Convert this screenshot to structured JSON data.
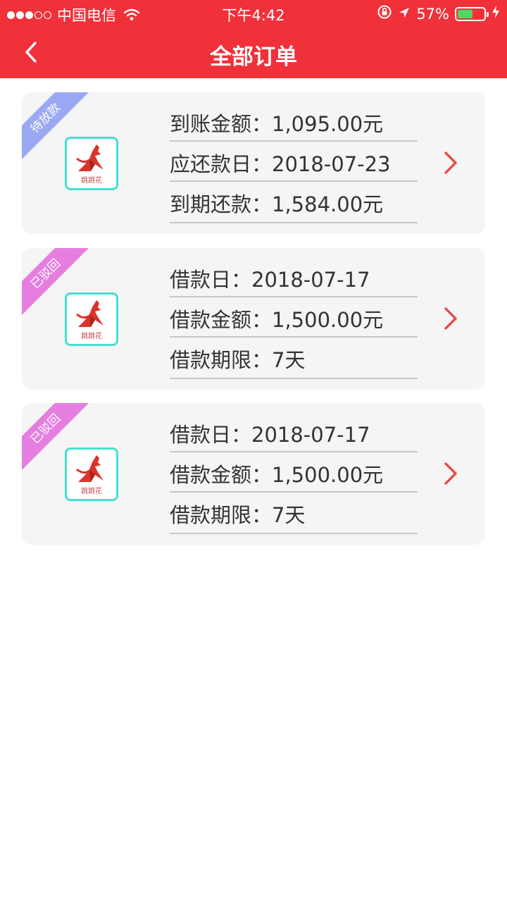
{
  "status_bar": {
    "carrier": "中国电信",
    "time": "下午4:42",
    "battery_percent": "57%",
    "battery_level": 0.57,
    "signal_filled": 3,
    "signal_total": 5
  },
  "nav": {
    "title": "全部订单"
  },
  "orders": [
    {
      "status": "待放款",
      "status_color": "#9aa9f2",
      "logo_text": "跳跳花",
      "lines": [
        "到账金额：1,095.00元",
        "应还款日：2018-07-23",
        "到期还款：1,584.00元"
      ]
    },
    {
      "status": "已驳回",
      "status_color": "#e57ee0",
      "logo_text": "跳跳花",
      "lines": [
        "借款日：2018-07-17",
        "借款金额：1,500.00元",
        "借款期限：7天"
      ]
    },
    {
      "status": "已驳回",
      "status_color": "#e57ee0",
      "logo_text": "跳跳花",
      "lines": [
        "借款日：2018-07-17",
        "借款金额：1,500.00元",
        "借款期限：7天"
      ]
    }
  ],
  "colors": {
    "header_red": "#f0313a",
    "card_bg": "#f5f5f5",
    "logo_border": "#47e0d2",
    "chevron": "#e84a4a"
  }
}
